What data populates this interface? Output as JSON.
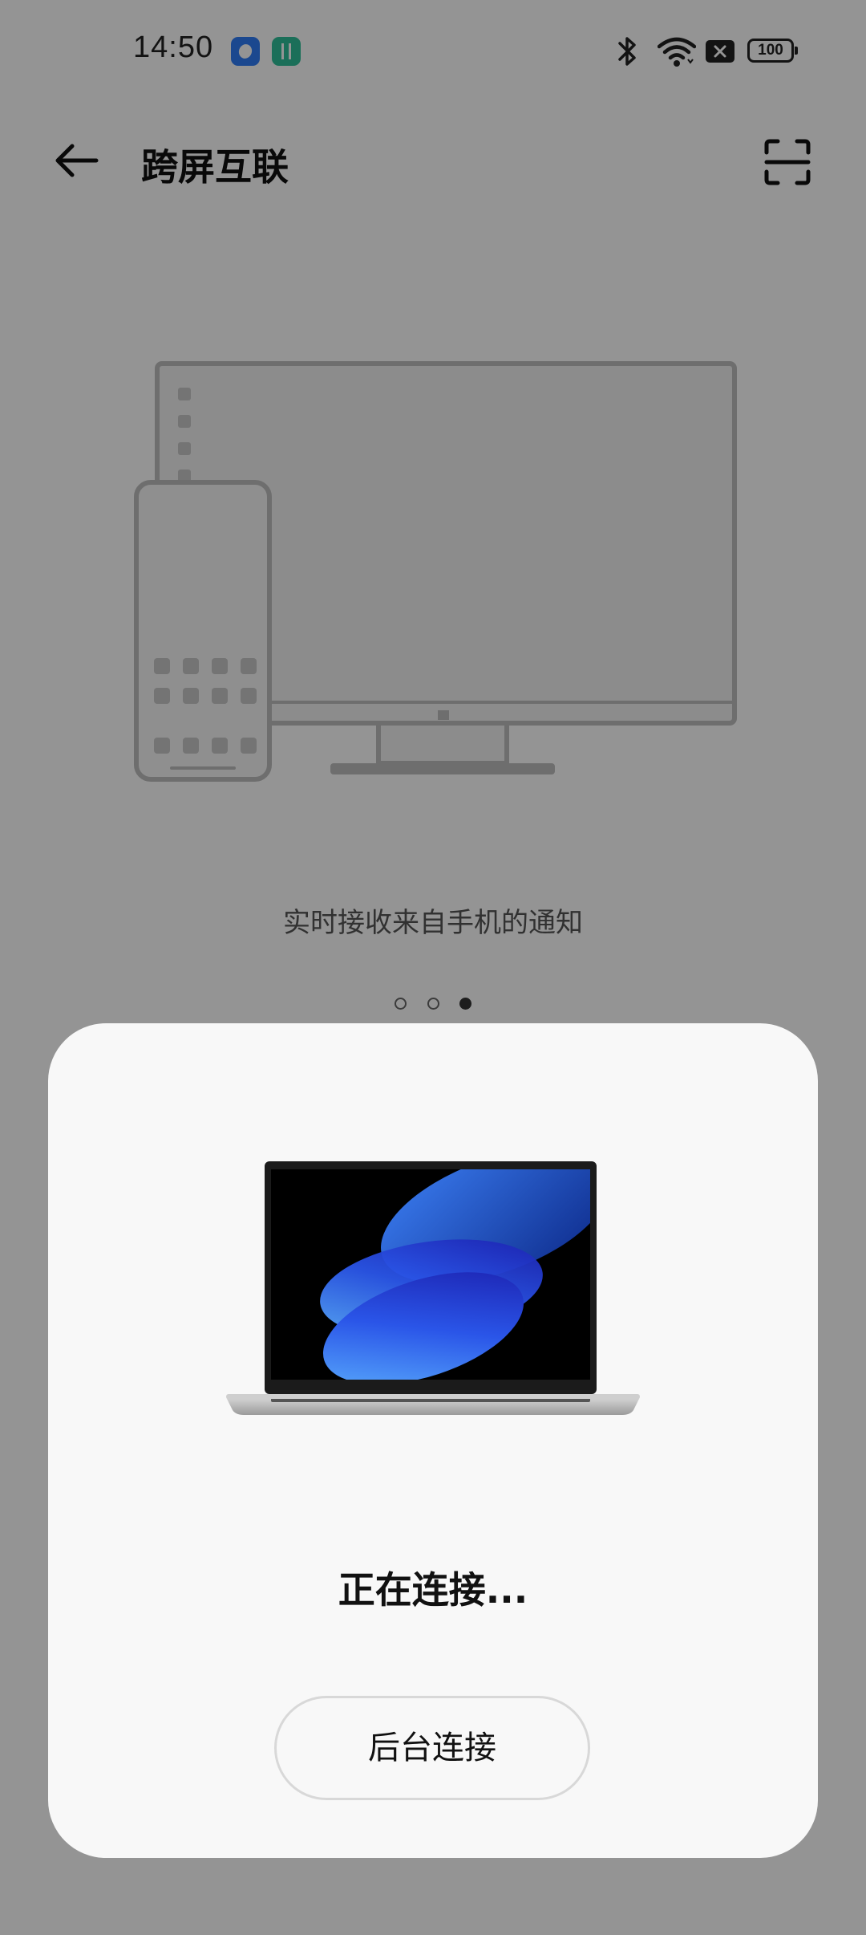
{
  "status_bar": {
    "time": "14:50",
    "battery": "100",
    "icons": [
      "app-notification-icon",
      "app-notification-icon",
      "bluetooth-icon",
      "wifi-icon",
      "sim-off-icon",
      "battery-icon"
    ]
  },
  "header": {
    "title": "跨屏互联",
    "back_icon": "back-arrow-icon",
    "scan_icon": "scan-icon"
  },
  "onboarding": {
    "caption": "实时接收来自手机的通知",
    "page_count": 3,
    "active_page": 3
  },
  "dialog": {
    "title": "正在连接...",
    "button_label": "后台连接"
  },
  "colors": {
    "scrim": "#6e6e6e",
    "dialog_bg": "#f8f8f8",
    "text": "#111111"
  }
}
